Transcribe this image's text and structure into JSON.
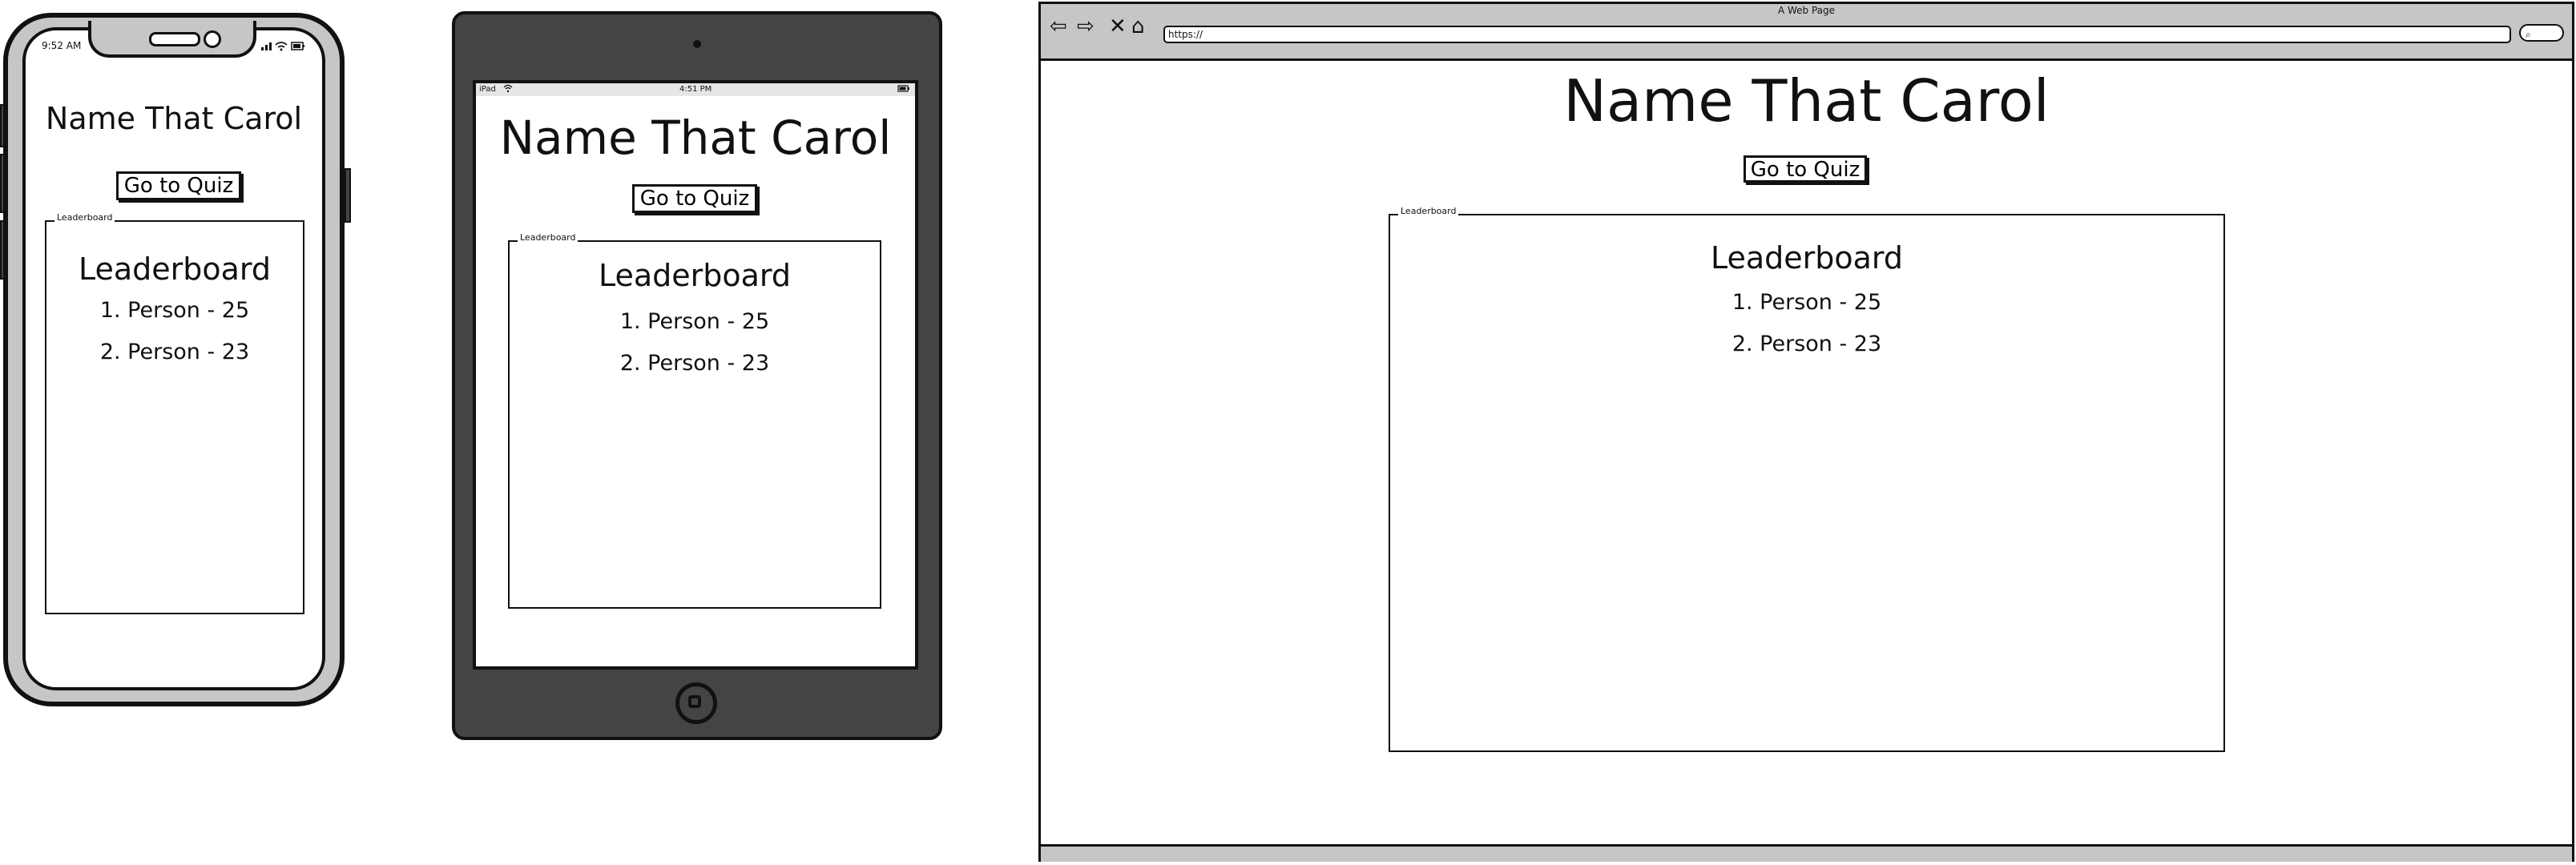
{
  "page": {
    "title": "Name That Carol",
    "quiz_button": "Go to Quiz"
  },
  "leaderboard": {
    "legend": "Leaderboard",
    "heading": "Leaderboard",
    "entries": [
      "1. Person - 25",
      "2. Person - 23"
    ]
  },
  "phone": {
    "status_time": "9:52 AM",
    "status_right_icons": "signal-wifi-battery"
  },
  "tablet": {
    "status_left": "iPad",
    "status_time": "4:51 PM"
  },
  "browser": {
    "window_title": "A Web Page",
    "url": "https://",
    "nav_icons": [
      "back-arrow",
      "forward-arrow",
      "close-x",
      "home"
    ]
  },
  "colors": {
    "frame_gray": "#c6c6c6",
    "tablet_body": "#444444",
    "ink": "#111111"
  }
}
